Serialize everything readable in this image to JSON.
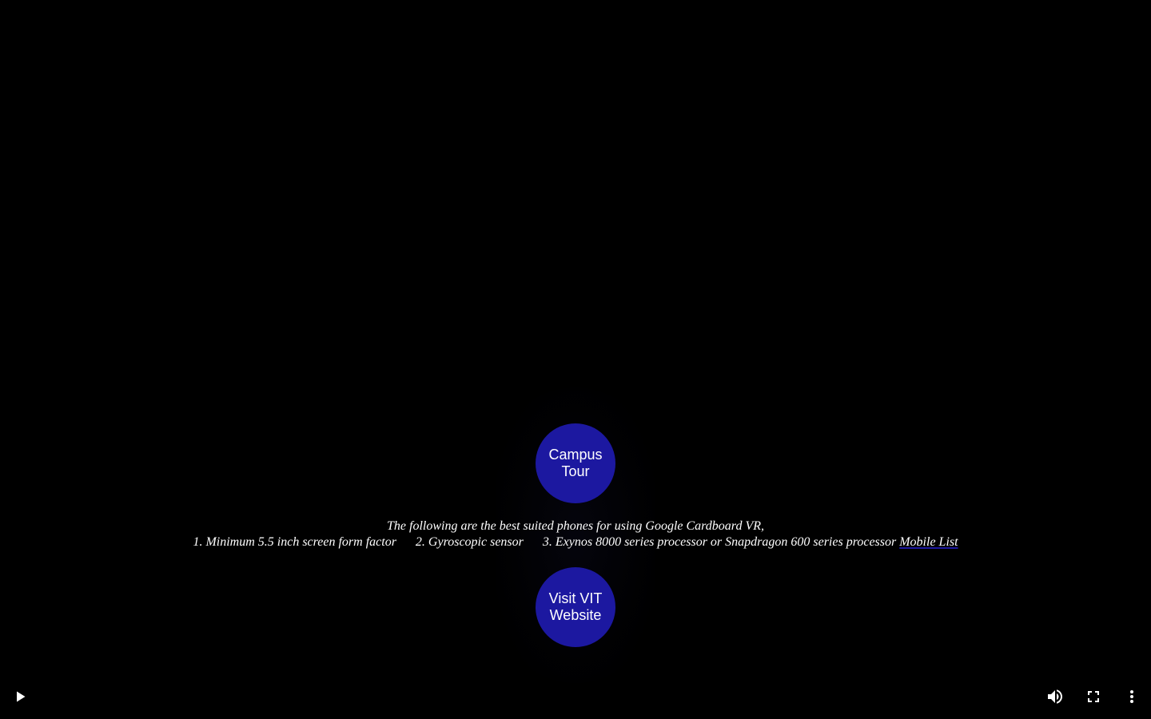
{
  "buttons": {
    "campus_tour": "Campus Tour",
    "visit_website": "Visit VIT Website"
  },
  "info": {
    "line1": "The following are the best suited phones for using Google Cardboard VR,",
    "req1": "1. Minimum 5.5 inch screen form factor",
    "req2": "2. Gyroscopic sensor",
    "req3": "3. Exynos 8000 series processor or Snapdragon 600 series processor",
    "link": "Mobile List"
  },
  "player_controls": {
    "icons": [
      "play-icon",
      "volume-icon",
      "fullscreen-icon",
      "more-options-icon"
    ]
  },
  "colors": {
    "background": "#000000",
    "button": "#1c18a0",
    "text": "#ffffff"
  }
}
